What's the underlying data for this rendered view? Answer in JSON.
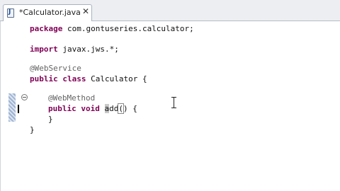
{
  "tab": {
    "label": "*Calculator.java",
    "close": "✕"
  },
  "code": {
    "line1": {
      "kw": "package",
      "rest": " com.gontuseries.calculator;"
    },
    "line2": {
      "kw": "import",
      "rest": " javax.jws.*;"
    },
    "line3": {
      "ann": "@WebService"
    },
    "line4": {
      "kw1": "public",
      "kw2": "class",
      "rest": " Calculator {"
    },
    "line5": {
      "ann": "@WebMethod"
    },
    "line6": {
      "kw1": "public",
      "kw2": "void",
      "name_sel": "a",
      "name_rest": "dd",
      "paren_open": "(",
      "paren_close": ")",
      "rest": " {"
    },
    "line7": {
      "text": "}"
    },
    "line8": {
      "text": "}"
    }
  }
}
